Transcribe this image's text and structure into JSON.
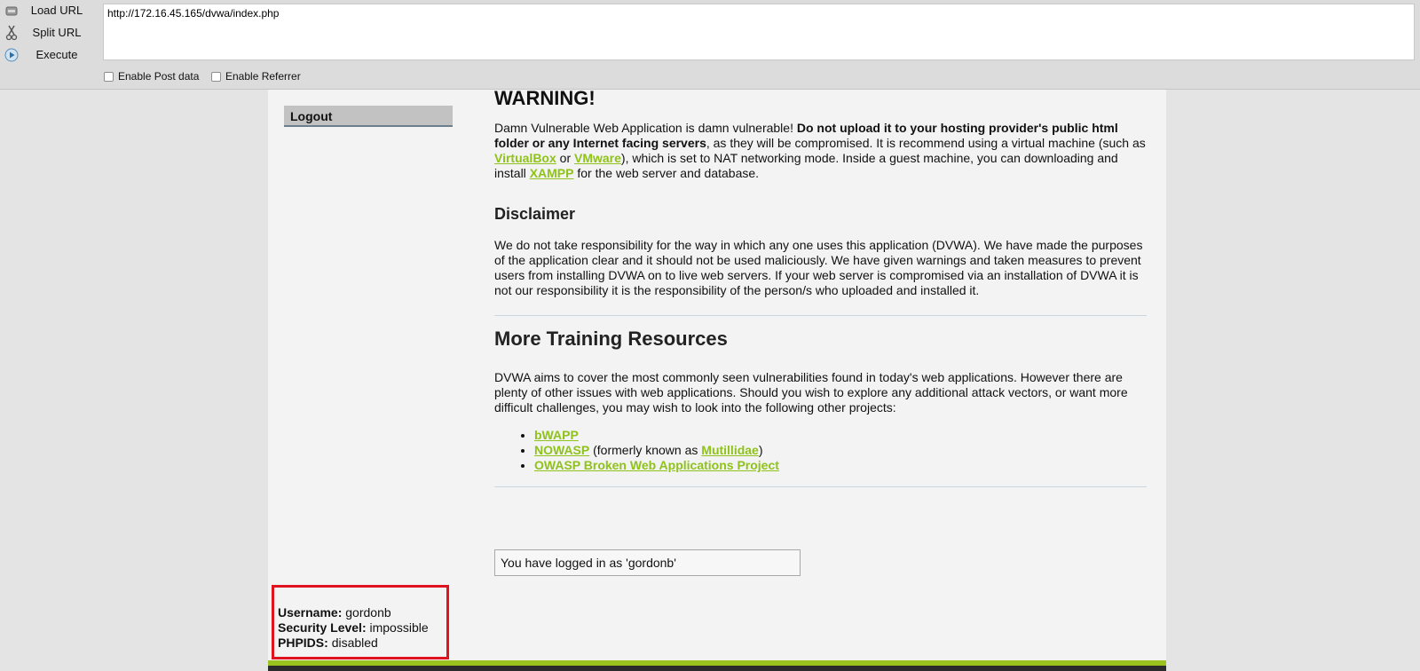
{
  "toolbar": {
    "actions": [
      {
        "label": "Load URL",
        "icon": "load-url-icon"
      },
      {
        "label": "Split URL",
        "icon": "scissors-icon"
      },
      {
        "label": "Execute",
        "icon": "play-icon"
      }
    ],
    "url": "http://172.16.45.165/dvwa/index.php",
    "checkboxes": [
      {
        "label": "Enable Post data",
        "checked": false
      },
      {
        "label": "Enable Referrer",
        "checked": false
      }
    ]
  },
  "sidebar": {
    "logout_label": "Logout"
  },
  "main": {
    "warning_heading": "WARNING!",
    "warning": {
      "t1": "Damn Vulnerable Web Application is damn vulnerable! ",
      "bold": "Do not upload it to your hosting provider's public html folder or any Internet facing servers",
      "t2": ", as they will be compromised. It is recommend using a virtual machine (such as ",
      "link_virtualbox": "VirtualBox",
      "t3": " or ",
      "link_vmware": "VMware",
      "t4": "), which is set to NAT networking mode. Inside a guest machine, you can downloading and install ",
      "link_xampp": "XAMPP",
      "t5": " for the web server and database."
    },
    "disclaimer_heading": "Disclaimer",
    "disclaimer_text": "We do not take responsibility for the way in which any one uses this application (DVWA). We have made the purposes of the application clear and it should not be used maliciously. We have given warnings and taken measures to prevent users from installing DVWA on to live web servers. If your web server is compromised via an installation of DVWA it is not our responsibility it is the responsibility of the person/s who uploaded and installed it.",
    "resources_heading": "More Training Resources",
    "resources_text": "DVWA aims to cover the most commonly seen vulnerabilities found in today's web applications. However there are plenty of other issues with web applications. Should you wish to explore any additional attack vectors, or want more difficult challenges, you may wish to look into the following other projects:",
    "projects": {
      "bwapp": "bWAPP",
      "nowasp": "NOWASP",
      "nowasp_mid": " (formerly known as ",
      "mutillidae": "Mutillidae",
      "nowasp_end": ")",
      "owasp": "OWASP Broken Web Applications Project"
    },
    "logged_in_message": "You have logged in as 'gordonb'"
  },
  "user_info": {
    "username_label": "Username:",
    "username": "gordonb",
    "security_label": "Security Level:",
    "security": "impossible",
    "phpids_label": "PHPIDS:",
    "phpids": "disabled"
  },
  "colors": {
    "link": "#8fc21a",
    "highlight_box": "#e0141e",
    "footer_green": "#9ac31d"
  }
}
